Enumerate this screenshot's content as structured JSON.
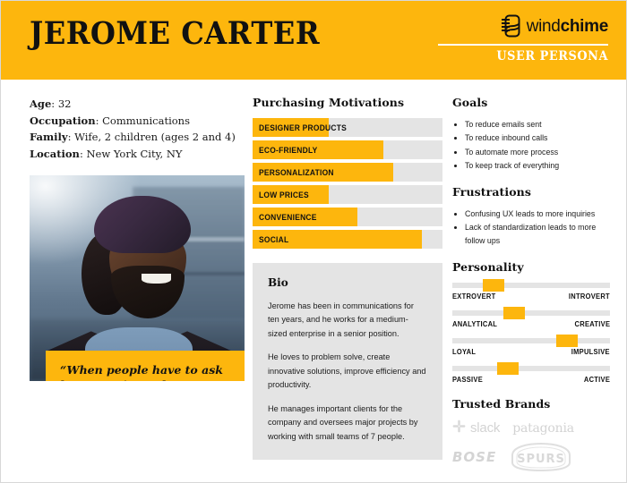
{
  "header": {
    "persona_name": "JEROME CARTER",
    "brand_name_light": "wind",
    "brand_name_bold": "chime",
    "brand_subtitle": "USER PERSONA",
    "brand_icon": "windchime-icon",
    "background_color": "#FDB60D"
  },
  "demographics": [
    {
      "label": "Age",
      "value": "32"
    },
    {
      "label": "Occupation",
      "value": "Communications"
    },
    {
      "label": "Family",
      "value": "Wife, 2 children (ages 2 and 4)"
    },
    {
      "label": "Location",
      "value": "New York City, NY"
    }
  ],
  "photo": {
    "alt": "Portrait of Jerome Carter smiling, wearing a beanie and denim shirt"
  },
  "quote": {
    "text": "“When people have to ask less questions, the team gets more work done.”"
  },
  "purchasing": {
    "title": "Purchasing Motivations",
    "items": [
      {
        "label": "DESIGNER PRODUCTS",
        "value": 40
      },
      {
        "label": "ECO-FRIENDLY",
        "value": 69
      },
      {
        "label": "PERSONALIZATION",
        "value": 74
      },
      {
        "label": "LOW PRICES",
        "value": 40
      },
      {
        "label": "CONVENIENCE",
        "value": 55
      },
      {
        "label": "SOCIAL",
        "value": 89
      }
    ]
  },
  "bio": {
    "title": "Bio",
    "paragraphs": [
      "Jerome has been in communications for ten years, and he works for a medium-sized enterprise in a senior position.",
      "He loves to problem solve, create innovative solutions, improve efficiency and productivity.",
      "He manages important clients for the company and oversees major projects by working with small teams of 7 people."
    ]
  },
  "goals": {
    "title": "Goals",
    "items": [
      "To reduce emails sent",
      "To reduce inbound calls",
      "To automate more process",
      "To keep track of everything"
    ]
  },
  "frustrations": {
    "title": "Frustrations",
    "items": [
      "Confusing UX leads to more inquiries",
      "Lack of standardization leads to more follow ups"
    ]
  },
  "personality": {
    "title": "Personality",
    "scales": [
      {
        "left": "EXTROVERT",
        "right": "INTROVERT",
        "value": 26
      },
      {
        "left": "ANALYTICAL",
        "right": "CREATIVE",
        "value": 39
      },
      {
        "left": "LOYAL",
        "right": "IMPULSIVE",
        "value": 73
      },
      {
        "left": "PASSIVE",
        "right": "ACTIVE",
        "value": 35
      }
    ]
  },
  "trusted_brands": {
    "title": "Trusted Brands",
    "items": [
      {
        "name": "slack",
        "icon": "slack-icon"
      },
      {
        "name": "patagonia",
        "icon": "patagonia-wordmark"
      },
      {
        "name": "BOSE",
        "icon": "bose-wordmark"
      },
      {
        "name": "SPURS",
        "icon": "spurs-logo"
      }
    ]
  },
  "chart_data": {
    "type": "bar",
    "title": "Purchasing Motivations",
    "categories": [
      "DESIGNER PRODUCTS",
      "ECO-FRIENDLY",
      "PERSONALIZATION",
      "LOW PRICES",
      "CONVENIENCE",
      "SOCIAL"
    ],
    "values": [
      40,
      69,
      74,
      40,
      55,
      89
    ],
    "xlabel": "",
    "ylabel": "",
    "xlim": [
      0,
      100
    ],
    "orientation": "horizontal",
    "grid": false,
    "legend": false
  }
}
